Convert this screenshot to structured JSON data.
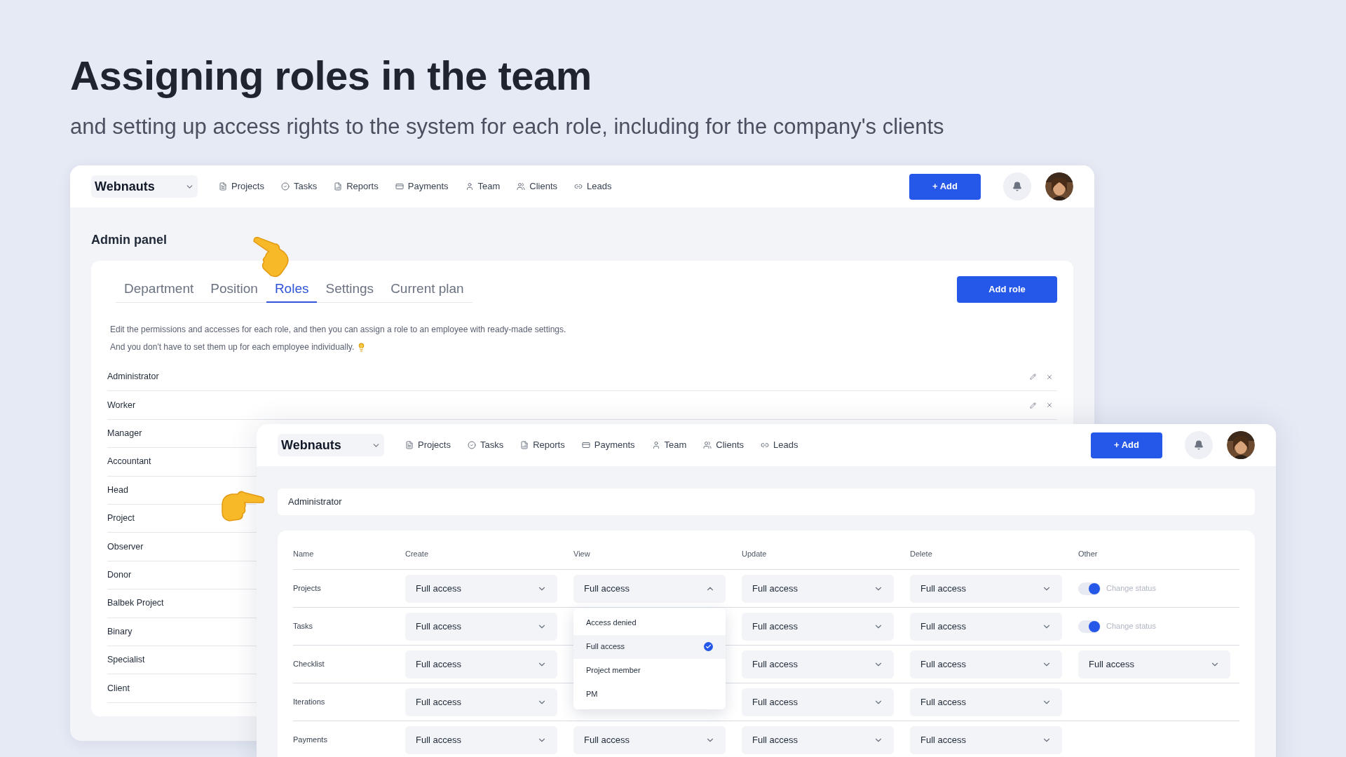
{
  "heading": "Assigning roles in the team",
  "subheading": "and setting up access rights to the system for each role, including for the company's clients",
  "back_window": {
    "logo": "Webnauts",
    "nav": [
      "Projects",
      "Tasks",
      "Reports",
      "Payments",
      "Team",
      "Clients",
      "Leads"
    ],
    "add_button": "+ Add",
    "page_title": "Admin panel",
    "tabs": [
      {
        "label": "Department",
        "selected": false
      },
      {
        "label": "Position",
        "selected": false
      },
      {
        "label": "Roles",
        "selected": true
      },
      {
        "label": "Settings",
        "selected": false
      },
      {
        "label": "Current plan",
        "selected": false
      }
    ],
    "add_role_button": "Add role",
    "description": [
      "Edit the permissions and accesses for each role, and then you can assign a role to an employee with ready-made settings.",
      "And you don't have to set them up for each employee individually."
    ],
    "roles": [
      {
        "name": "Administrator",
        "editable": true
      },
      {
        "name": "Worker",
        "editable": true
      },
      {
        "name": "Manager"
      },
      {
        "name": "Accountant"
      },
      {
        "name": "Head"
      },
      {
        "name": "Project"
      },
      {
        "name": "Observer"
      },
      {
        "name": "Donor"
      },
      {
        "name": "Balbek Project"
      },
      {
        "name": "Binary"
      },
      {
        "name": "Specialist"
      },
      {
        "name": "Client"
      }
    ]
  },
  "front_window": {
    "logo": "Webnauts",
    "nav": [
      "Projects",
      "Tasks",
      "Reports",
      "Payments",
      "Team",
      "Clients",
      "Leads"
    ],
    "add_button": "+ Add",
    "role_name": "Administrator",
    "columns": [
      "Name",
      "Create",
      "View",
      "Update",
      "Delete",
      "Other"
    ],
    "rows": [
      {
        "name": "Projects",
        "cells": [
          {
            "value": "Full access",
            "expanded": false
          },
          {
            "value": "Full access",
            "expanded": true,
            "options": [
              {
                "label": "Access denied",
                "selected": false
              },
              {
                "label": "Full access",
                "selected": true
              },
              {
                "label": "Project member",
                "selected": false
              },
              {
                "label": "PM",
                "selected": false
              }
            ]
          },
          {
            "value": "Full access",
            "expanded": false
          },
          {
            "value": "Full access",
            "expanded": false
          }
        ],
        "other": {
          "kind": "toggle",
          "on": true,
          "label": "Change status"
        }
      },
      {
        "name": "Tasks",
        "cells": [
          {
            "value": "Full access",
            "expanded": false
          },
          null,
          {
            "value": "Full access",
            "expanded": false
          },
          {
            "value": "Full access",
            "expanded": false
          }
        ],
        "other": {
          "kind": "toggle",
          "on": true,
          "label": "Change status"
        }
      },
      {
        "name": "Checklist",
        "cells": [
          {
            "value": "Full access",
            "expanded": false
          },
          null,
          {
            "value": "Full access",
            "expanded": false
          },
          {
            "value": "Full access",
            "expanded": false
          }
        ],
        "other": {
          "kind": "select",
          "value": "Full access"
        }
      },
      {
        "name": "Iterations",
        "cells": [
          {
            "value": "Full access",
            "expanded": false
          },
          null,
          {
            "value": "Full access",
            "expanded": false
          },
          {
            "value": "Full access",
            "expanded": false
          }
        ]
      },
      {
        "name": "Payments",
        "cells": [
          {
            "value": "Full access",
            "expanded": false
          },
          {
            "value": "Full access",
            "expanded": false
          },
          {
            "value": "Full access",
            "expanded": false
          },
          {
            "value": "Full access",
            "expanded": false
          }
        ]
      }
    ]
  }
}
